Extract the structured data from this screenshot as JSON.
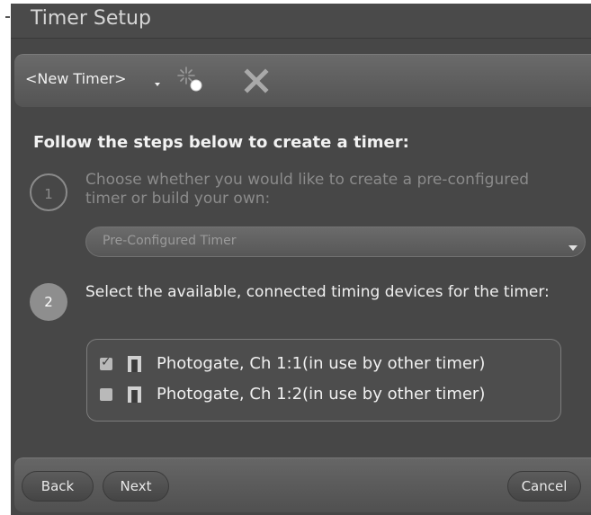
{
  "window": {
    "title": "Timer Setup"
  },
  "toolbar": {
    "timer_select": "<New Timer>",
    "new_icon": "sparkle-new-icon",
    "close_icon": "close-x-icon"
  },
  "instructions": {
    "heading": "Follow the steps below to create a timer:"
  },
  "steps": [
    {
      "number": "1",
      "text": "Choose whether you would like to create a pre-configured timer or build your own:",
      "select_value": "Pre-Configured Timer"
    },
    {
      "number": "2",
      "text": "Select the available, connected timing devices for the timer:"
    }
  ],
  "devices": [
    {
      "label": "Photogate, Ch 1:1(in use by other timer)",
      "checked": true,
      "icon": "photogate-sensor-icon"
    },
    {
      "label": "Photogate, Ch 1:2(in use by other timer)",
      "checked": false,
      "icon": "photogate-sensor-icon"
    }
  ],
  "footer": {
    "back_label": "Back",
    "next_label": "Next",
    "cancel_label": "Cancel"
  },
  "colors": {
    "panel_bg": "#474747",
    "text_light": "#f0f0f0",
    "text_disabled": "#8b8b8b",
    "checkbox": "#b9b9b9"
  }
}
